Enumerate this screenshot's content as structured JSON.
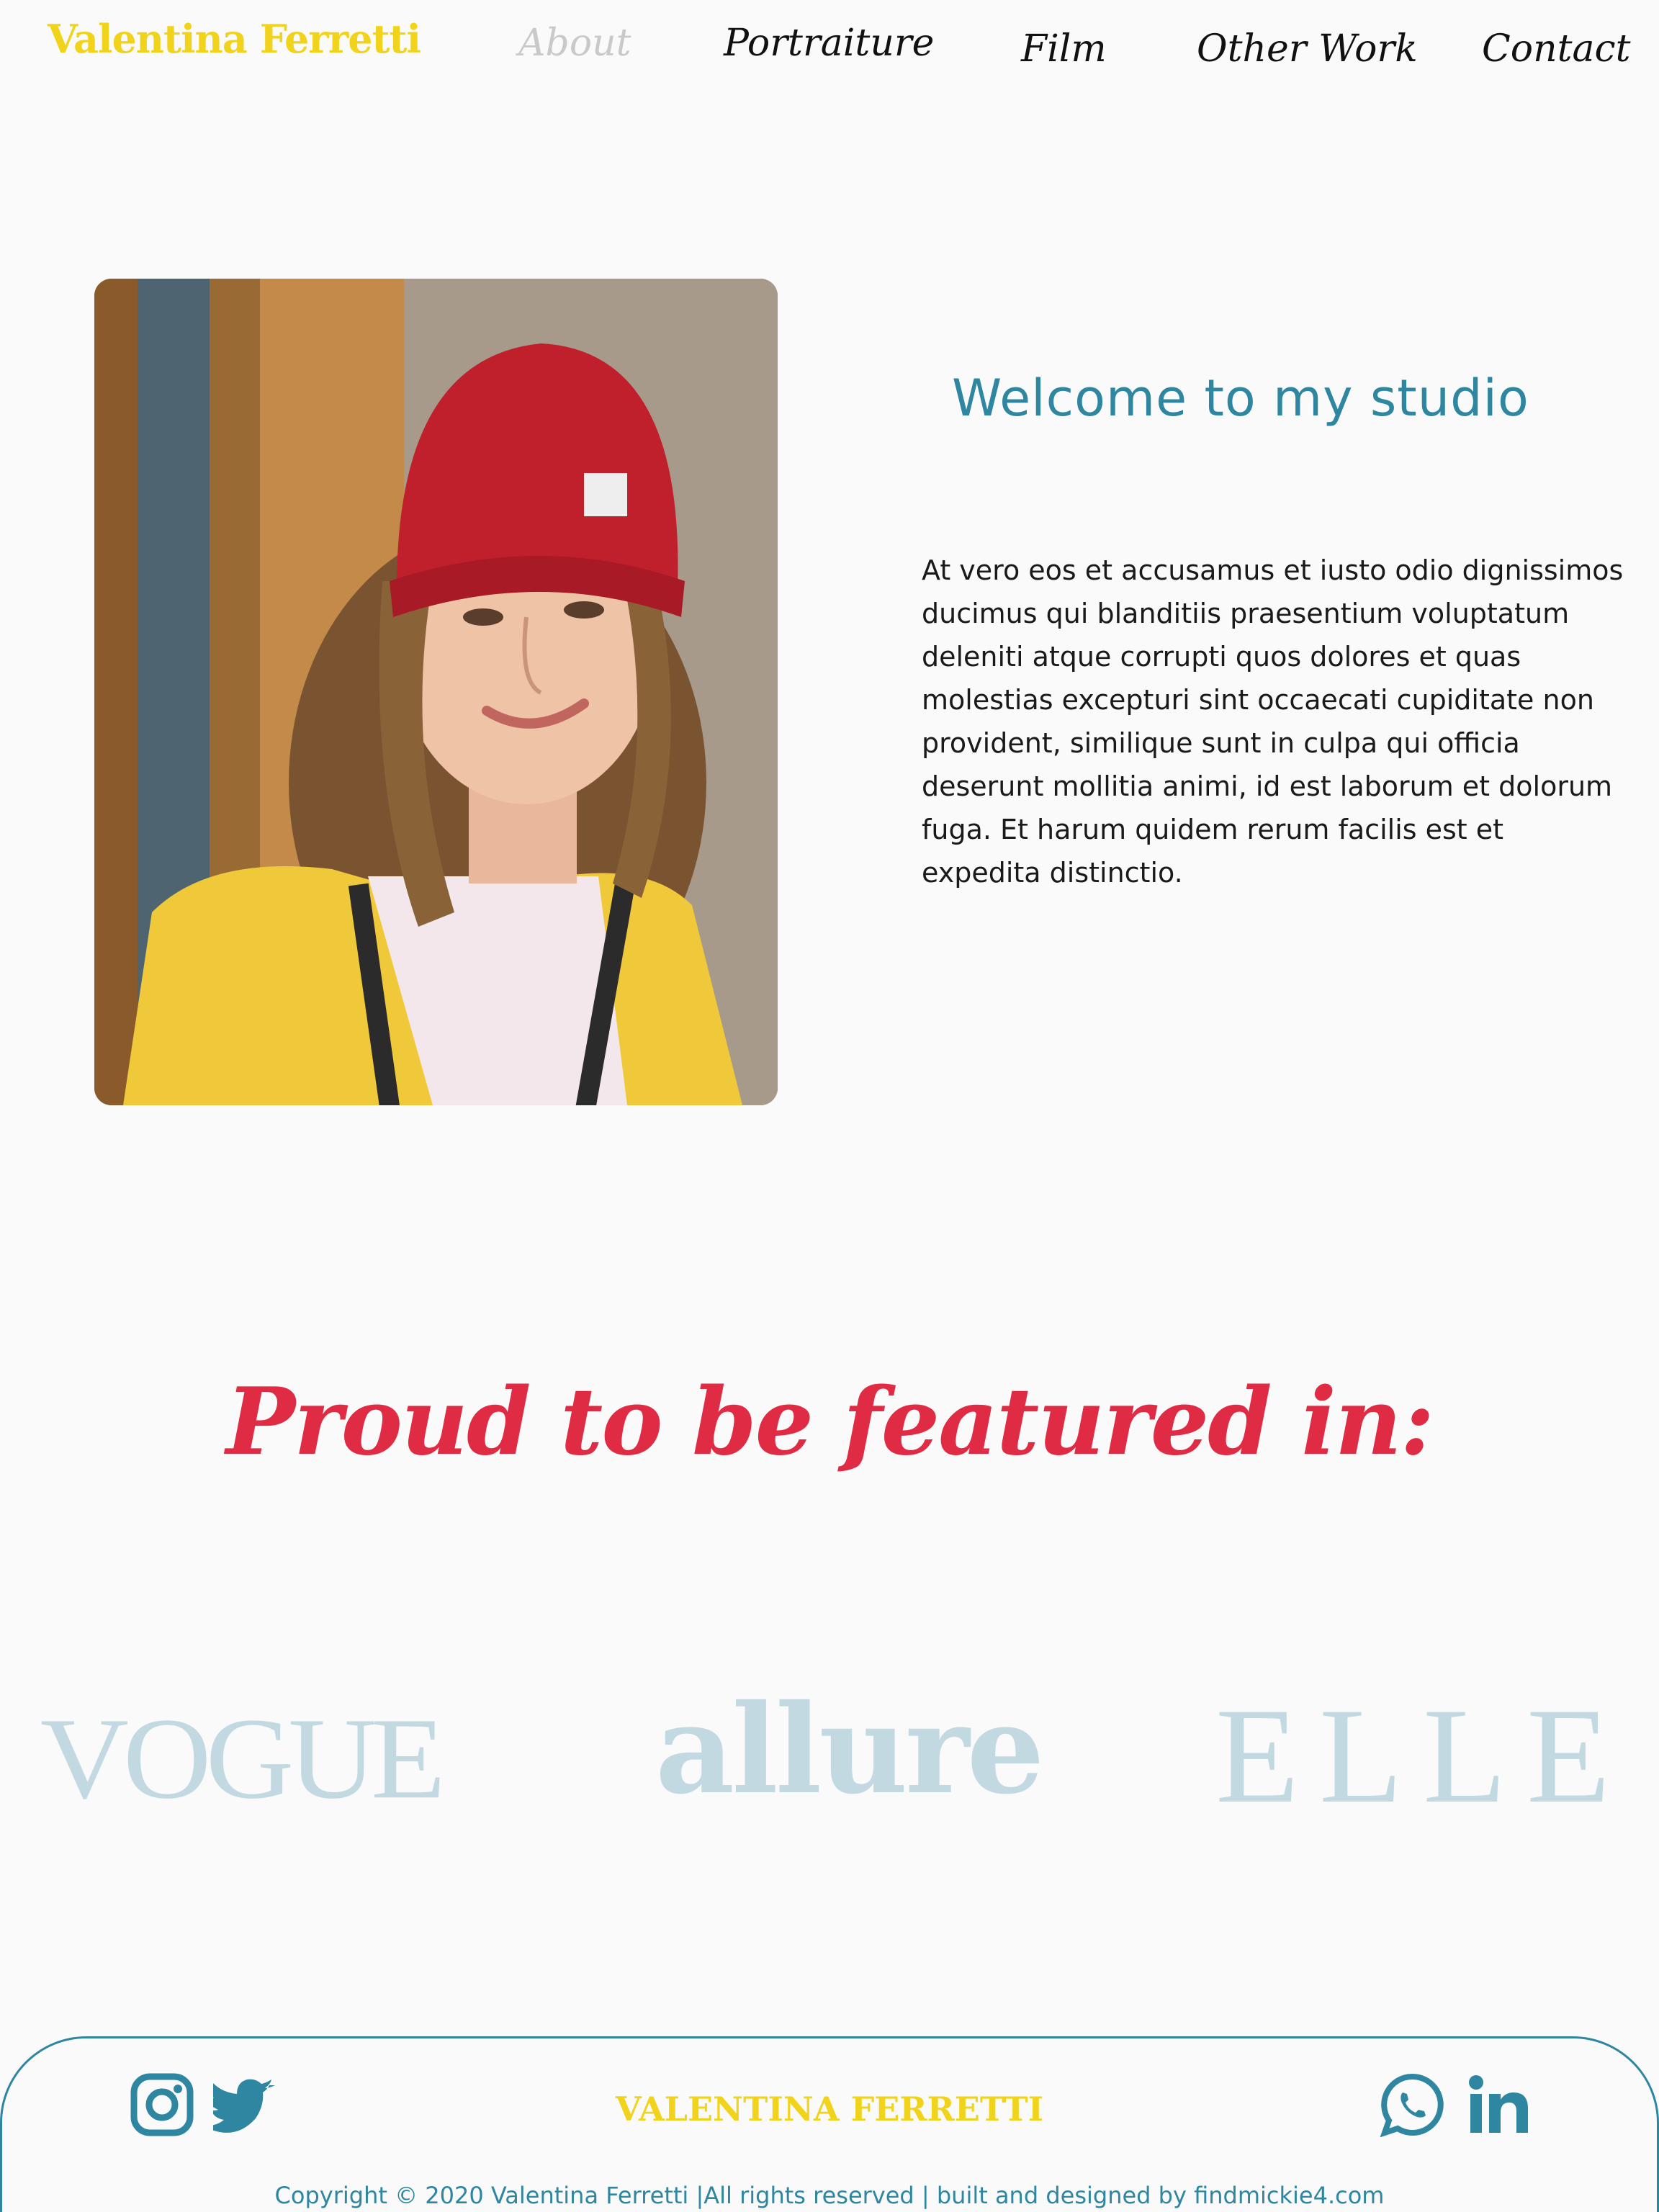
{
  "header": {
    "brand": "Valentina Ferretti",
    "nav": [
      "About",
      "Portraiture",
      "Film",
      "Other Work",
      "Contact"
    ],
    "active": "About"
  },
  "welcome": {
    "title": "Welcome to my studio",
    "body": "At vero eos et accusamus et iusto odio dignissimos ducimus qui blanditiis praesentium voluptatum deleniti atque corrupti quos dolores et quas molestias excepturi sint occaecati cupiditate non provident, similique sunt in culpa qui officia deserunt mollitia animi, id est laborum et dolorum fuga. Et harum quidem rerum facilis est et expedita distinctio."
  },
  "featured": {
    "title": "Proud to be featured in:",
    "logos": [
      "VOGUE",
      "allure",
      "ELLE"
    ]
  },
  "footer": {
    "brand": "VALENTINA FERRETTI",
    "copyright": "Copyright © 2020 Valentina Ferretti |All rights reserved | built and designed by findmickie4.com",
    "icons": [
      "instagram-icon",
      "twitter-icon",
      "whatsapp-icon",
      "linkedin-icon"
    ]
  },
  "colors": {
    "brand_yellow": "#f2d31b",
    "accent_blue": "#2e86a0",
    "accent_red": "#e02b44",
    "press_logo": "#c3d9e1"
  }
}
